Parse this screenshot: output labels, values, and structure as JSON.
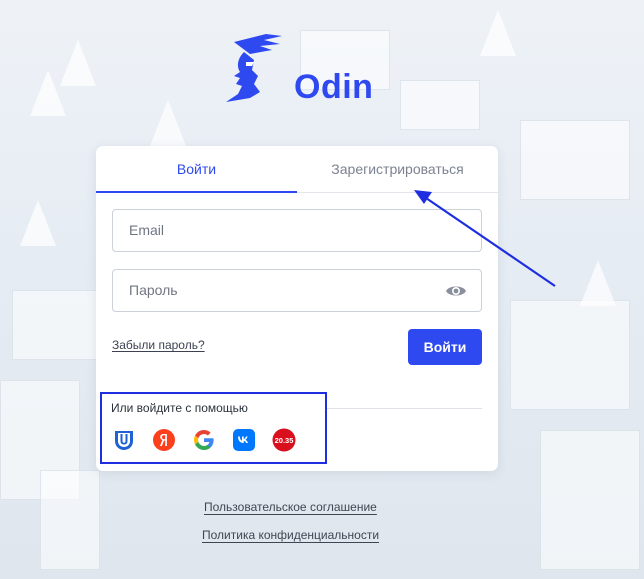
{
  "brand": {
    "name": "Odin",
    "color": "#2f49f0",
    "logo_icon": "viking-head-icon"
  },
  "tabs": [
    {
      "label": "Войти",
      "active": true
    },
    {
      "label": "Зарегистрироваться",
      "active": false
    }
  ],
  "form": {
    "email_placeholder": "Email",
    "password_placeholder": "Пароль",
    "show_password_icon": "eye-icon",
    "forgot_label": "Забыли пароль?",
    "submit_label": "Войти"
  },
  "social": {
    "title": "Или войдите с помощью",
    "providers": [
      {
        "name": "unti-icon",
        "color": "#1e62d6"
      },
      {
        "name": "yandex-icon",
        "color": "#fc3f1d"
      },
      {
        "name": "google-icon",
        "color": "#4285f4"
      },
      {
        "name": "vk-icon",
        "color": "#0077ff"
      },
      {
        "name": "2035-icon",
        "color": "#d90f1d",
        "label": "20.35"
      }
    ]
  },
  "footer": {
    "terms": "Пользовательское соглашение",
    "privacy": "Политика конфиденциальности"
  }
}
